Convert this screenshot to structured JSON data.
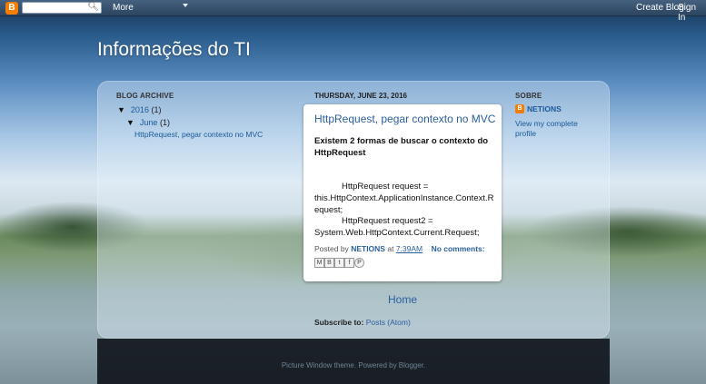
{
  "navbar": {
    "search_placeholder": "",
    "more_label": "More",
    "create_blog_label": "Create Blog",
    "sign_in_label": "Sign In"
  },
  "blog": {
    "title": "Informações do TI"
  },
  "sidebar_left": {
    "heading": "BLOG ARCHIVE",
    "year": {
      "label": "2016",
      "count": "(1)",
      "arrow": "▼"
    },
    "month": {
      "label": "June",
      "count": "(1)",
      "arrow": "▼"
    },
    "post_link": "HttpRequest, pegar contexto no MVC"
  },
  "main": {
    "date_header": "THURSDAY, JUNE 23, 2016",
    "post": {
      "title": "HttpRequest, pegar contexto no MVC",
      "intro": "Existem 2 formas de buscar o contexto do HttpRequest",
      "code_line1a": "HttpRequest request =",
      "code_line1b": "this.HttpContext.ApplicationInstance.Context.Request;",
      "code_line2a": "HttpRequest request2 =",
      "code_line2b": "System.Web.HttpContext.Current.Request;",
      "posted_by_label": "Posted by",
      "author": "NETIONS",
      "at_label": "at",
      "time": "7:39AM",
      "comments": "No comments:",
      "share_buttons": [
        "M",
        "B",
        "t",
        "f",
        "P"
      ]
    },
    "home_label": "Home",
    "subscribe_label": "Subscribe to:",
    "subscribe_link": "Posts (Atom)"
  },
  "sidebar_right": {
    "heading": "SOBRE",
    "profile_name": "NETIONS",
    "profile_link": "View my complete profile"
  },
  "footer": {
    "text": "Picture Window theme. Powered by Blogger."
  }
}
